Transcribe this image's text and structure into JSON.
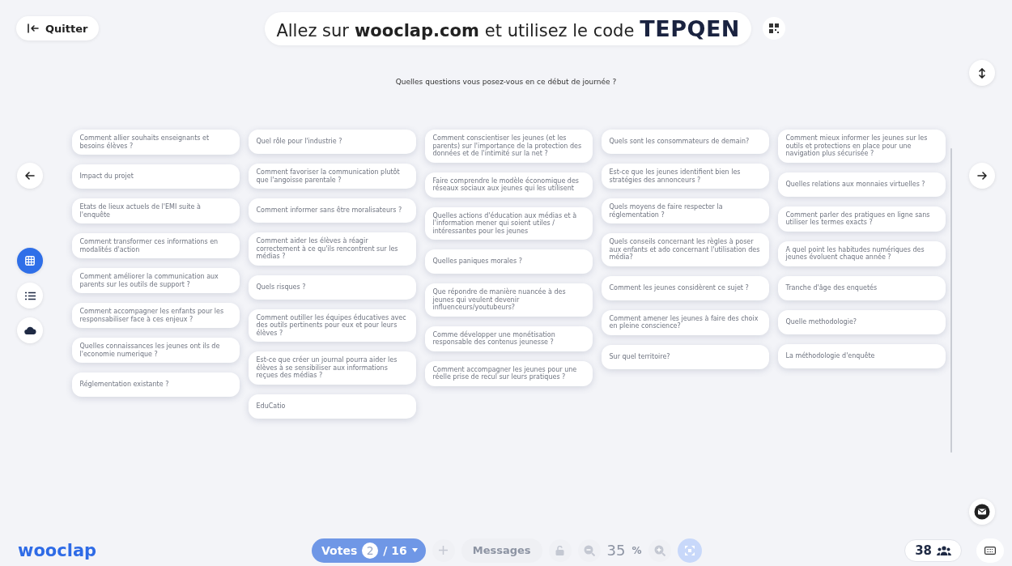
{
  "header": {
    "quit_button": "Quitter",
    "join_prefix": "Allez sur",
    "join_site": "wooclap.com",
    "join_middle": "et utilisez le code",
    "join_code": "TEPQEN"
  },
  "question": "Quelles questions vous posez-vous en ce début de journée ?",
  "view_modes": [
    {
      "kind": "grid",
      "selected": true
    },
    {
      "kind": "list",
      "selected": false
    },
    {
      "kind": "cloud",
      "selected": false
    }
  ],
  "columns": [
    [
      "Comment allier souhaits enseignants et besoins élèves ?",
      "Impact du projet",
      "Etats de lieux actuels de l'EMI suite à l'enquête",
      "Comment transformer ces informations en modalités d'action",
      "Comment améliorer la communication aux parents sur les outils de support ?",
      "Comment accompagner les enfants pour les responsabiliser face à ces enjeux ?",
      "Quelles connaissances les jeunes ont ils de l'economie numerique ?",
      "Réglementation existante ?"
    ],
    [
      "Quel rôle pour l'industrie ?",
      "Comment favoriser la communication plutôt que l'angoisse parentale ?",
      "Comment informer sans être moralisateurs ?",
      "Comment aider les élèves à réagir correctement à ce qu'ils rencontrent sur les médias ?",
      "Quels risques ?",
      "Comment outiller les équipes éducatives avec des outils pertinents pour eux et pour leurs élèves ?",
      "Est-ce que créer un journal pourra aider les élèves à se sensibiliser aux informations reçues des médias ?",
      "EduCatio"
    ],
    [
      "Comment conscientiser les jeunes (et les parents) sur l'importance de  la protection des données et de l'intimité sur la net ?",
      "Faire comprendre le modèle économique des réseaux sociaux aux jeunes qui les utilisent",
      "Quelles actions d'éducation aux médias et à l'information mener qui soient utiles / intéressantes pour les jeunes",
      "Quelles paniques morales ?",
      "Que répondre de manière nuancée à des jeunes qui veulent devenir influenceurs/youtubeurs?",
      "Comme développer une monétisation responsable des contenus jeunesse ?",
      "Comment accompagner les jeunes pour une réelle prise de recul sur leurs pratiques ?"
    ],
    [
      "Quels sont les consommateurs de demain?",
      "Est-ce que les jeunes identifient bien les stratégies des annonceurs ?",
      "Quels moyens de faire respecter la réglementation ?",
      "Quels conseils concernant les règles à poser aux enfants et ado concernant l'utilisation des média?",
      "Comment les jeunes considèrent ce sujet ?",
      "Comment amener les jeunes à faire des choix en pleine conscience?",
      "Sur quel territoire?"
    ],
    [
      "Comment mieux informer les jeunes sur les outils et protections en place pour une navigation plus sécurisée ?",
      "Quelles relations aux monnaies virtuelles ?",
      "Comment parler des pratiques en ligne sans utiliser les termes exacts ?",
      "A quel point les habitudes numériques des jeunes évoluent chaque année ?",
      "Tranche d'âge des enquetés",
      "Quelle methodologie?",
      "La méthodologie d'enquête"
    ]
  ],
  "footer": {
    "logo": "wooclap",
    "votes_label": "Votes",
    "votes_current": "2",
    "votes_total": "/ 16",
    "messages": "Messages",
    "zoom_value": "35",
    "zoom_unit": "%",
    "participants": "38"
  }
}
